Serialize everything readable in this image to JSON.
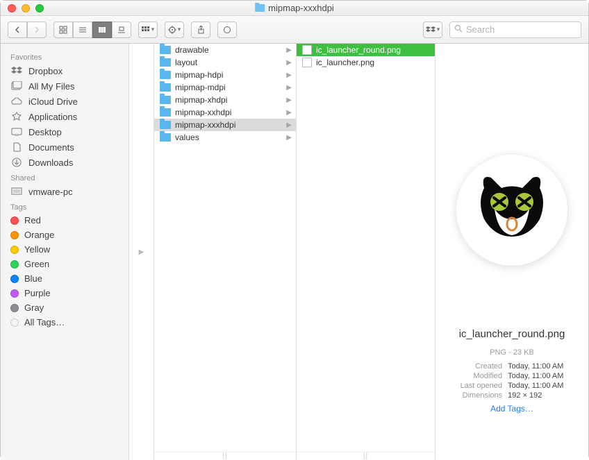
{
  "window": {
    "title": "mipmap-xxxhdpi"
  },
  "search": {
    "placeholder": "Search"
  },
  "sidebar": {
    "favorites_label": "Favorites",
    "favorites": [
      {
        "label": "Dropbox",
        "icon": "dropbox"
      },
      {
        "label": "All My Files",
        "icon": "allfiles"
      },
      {
        "label": "iCloud Drive",
        "icon": "cloud"
      },
      {
        "label": "Applications",
        "icon": "apps"
      },
      {
        "label": "Desktop",
        "icon": "desktop"
      },
      {
        "label": "Documents",
        "icon": "documents"
      },
      {
        "label": "Downloads",
        "icon": "downloads"
      }
    ],
    "shared_label": "Shared",
    "shared": [
      {
        "label": "vmware-pc",
        "icon": "pc"
      }
    ],
    "tags_label": "Tags",
    "tags": [
      {
        "label": "Red",
        "color": "#ff5257"
      },
      {
        "label": "Orange",
        "color": "#ff9500"
      },
      {
        "label": "Yellow",
        "color": "#ffcc00"
      },
      {
        "label": "Green",
        "color": "#30d158"
      },
      {
        "label": "Blue",
        "color": "#0a84ff"
      },
      {
        "label": "Purple",
        "color": "#bf5af2"
      },
      {
        "label": "Gray",
        "color": "#8e8e93"
      },
      {
        "label": "All Tags…",
        "color": "transparent"
      }
    ]
  },
  "column1": [
    {
      "label": "drawable"
    },
    {
      "label": "layout"
    },
    {
      "label": "mipmap-hdpi"
    },
    {
      "label": "mipmap-mdpi"
    },
    {
      "label": "mipmap-xhdpi"
    },
    {
      "label": "mipmap-xxhdpi"
    },
    {
      "label": "mipmap-xxxhdpi",
      "selected": true
    },
    {
      "label": "values"
    }
  ],
  "column2": [
    {
      "label": "ic_launcher_round.png",
      "selected": true
    },
    {
      "label": "ic_launcher.png"
    }
  ],
  "preview": {
    "filename": "ic_launcher_round.png",
    "type_size": "PNG - 23 KB",
    "created_k": "Created",
    "created_v": "Today, 11:00 AM",
    "modified_k": "Modified",
    "modified_v": "Today, 11:00 AM",
    "opened_k": "Last opened",
    "opened_v": "Today, 11:00 AM",
    "dim_k": "Dimensions",
    "dim_v": "192 × 192",
    "add_tags": "Add Tags…"
  }
}
